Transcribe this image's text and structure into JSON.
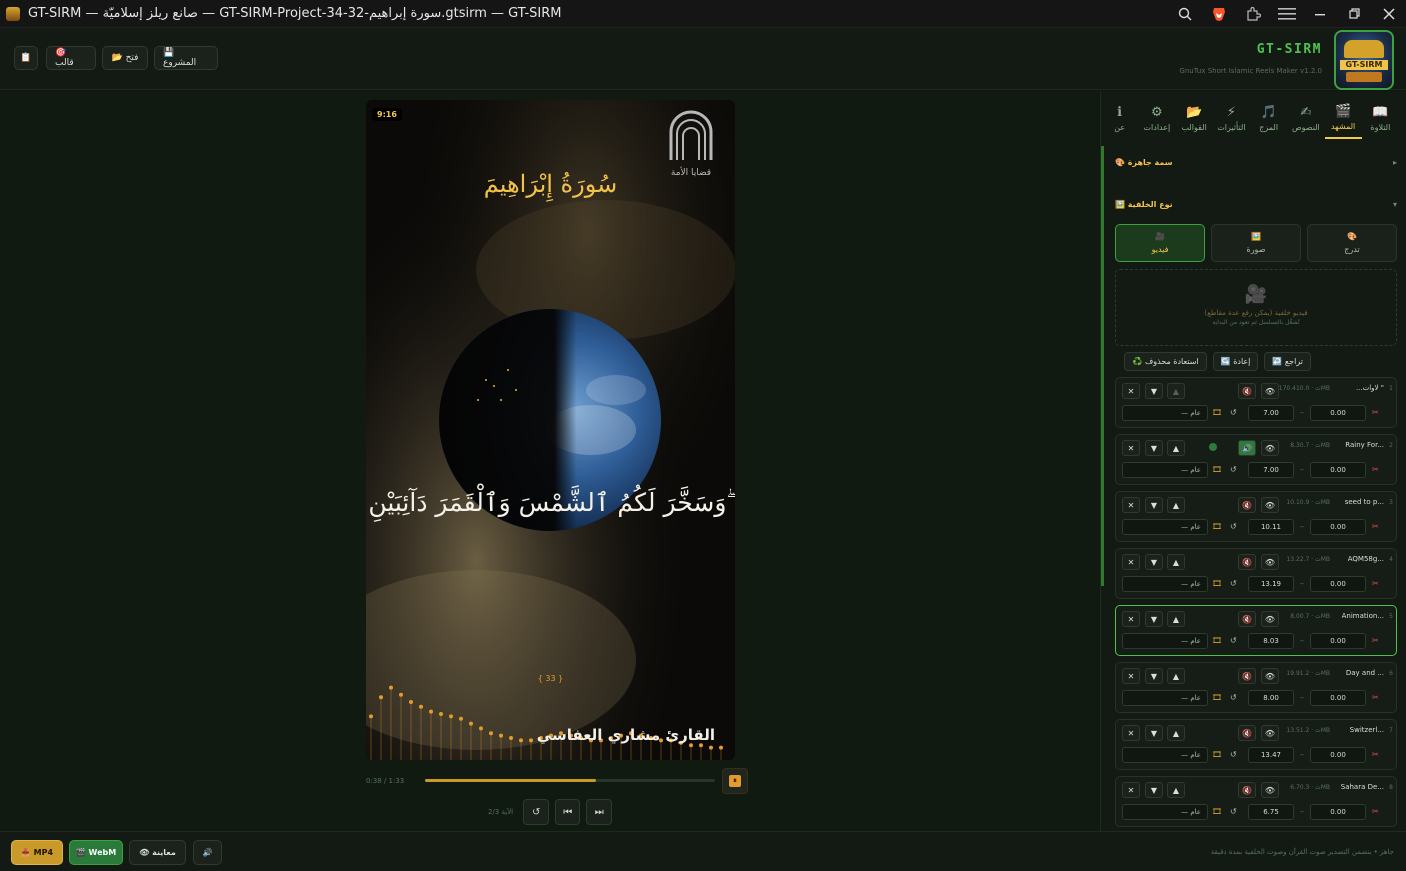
{
  "titlebar": {
    "title": "GT-SIRM — صانع ريلز إسلاميّة — GT-SIRM-Project-34-32-سورة إبراهيم.gtsirm — GT-SIRM",
    "icons": [
      "zoom-icon",
      "brave-lion-icon",
      "extensions-icon",
      "menu-icon",
      "minimize-icon",
      "restore-icon",
      "close-icon"
    ]
  },
  "header": {
    "project_label": "💾 المشروع",
    "open_label": "📂 فتح",
    "template_label": "🎯 قالب",
    "clipboard_label": "📋",
    "brand_name": "GT-SIRM",
    "brand_sub": "GnuTux Short Islamic Reels Maker v1.2.0",
    "logo_text": "GT-SIRM"
  },
  "preview": {
    "ratio_badge": "9:16",
    "surah_title": "سُورَةُ إِبْرَاهِيمَ",
    "ayah_text": "وَسَخَّرَ لَكُمُ ٱلشَّمْسَ وَٱلْقَمَرَ دَآئِبَيْنِ ۖ",
    "ayah_counter": "{ 33 }",
    "reciter": "القارئ مشاري العفاسي",
    "watermark_text": "قضايا الأمة",
    "time": "0:38 / 1:33",
    "progress": 0.59,
    "ayah_nav_label": "الآية 2/3",
    "pause_icon": "pause-icon"
  },
  "tabs": [
    {
      "icon": "📖",
      "label": "التلاوة"
    },
    {
      "icon": "🎬",
      "label": "المشهد",
      "active": true
    },
    {
      "icon": "✍",
      "label": "النصوص"
    },
    {
      "icon": "🎵",
      "label": "المزج"
    },
    {
      "icon": "⚡",
      "label": "التأثيرات"
    },
    {
      "icon": "📂",
      "label": "القوالب"
    },
    {
      "icon": "⚙",
      "label": "إعدادات"
    },
    {
      "icon": "ℹ",
      "label": "عن"
    }
  ],
  "sections": {
    "preset_title": "🎨 سمة جاهزة",
    "bg_type_title": "🖼️ نوع الخلفية",
    "collapsed_arrow": "▸",
    "expanded_arrow": "▾"
  },
  "bg_types": [
    {
      "icon": "🎨",
      "label": "تدرج"
    },
    {
      "icon": "🖼️",
      "label": "صورة"
    },
    {
      "icon": "🎥",
      "label": "فيديو",
      "active": true
    }
  ],
  "dropzone": {
    "icon": "🎥",
    "line1": "فيديو خلفية (يمكن رفع عدة مقاطع)",
    "line2": "تُشغَّل بالتسلسل ثم تعود من البداية"
  },
  "actions": {
    "undo": "↩️ تراجع",
    "redo": "↪️ إعادة",
    "restore": "♻️ استعادة محذوف"
  },
  "clips": [
    {
      "num": "1",
      "name": "...لاوات \"",
      "meta": "170.4ث · 10.0MB",
      "start": "0.00",
      "end": "7.00",
      "mode": "— عام"
    },
    {
      "num": "2",
      "name": "Rainy For...",
      "meta": "8.3ث · 0.7MB",
      "start": "0.00",
      "end": "7.00",
      "mode": "— عام"
    },
    {
      "num": "3",
      "name": "seed to p...",
      "meta": "10.1ث · 0.9MB",
      "start": "0.00",
      "end": "10.11",
      "mode": "— عام"
    },
    {
      "num": "4",
      "name": "AQM58g...",
      "meta": "13.2ث · 2.7MB",
      "start": "0.00",
      "end": "13.19",
      "mode": "— عام"
    },
    {
      "num": "5",
      "name": "Animation...",
      "meta": "8.0ث · 0.7MB",
      "start": "0.00",
      "end": "8.03",
      "mode": "— عام"
    },
    {
      "num": "6",
      "name": "Day and ...",
      "meta": "19.9ث · 1.2MB",
      "start": "0.00",
      "end": "8.00",
      "mode": "— عام"
    },
    {
      "num": "7",
      "name": "Switzerl...",
      "meta": "13.5ث · 1.2MB",
      "start": "0.00",
      "end": "13.47",
      "mode": "— عام"
    },
    {
      "num": "8",
      "name": "Sahara De...",
      "meta": "6.7ث · 0.3MB",
      "start": "0.00",
      "end": "6.75",
      "mode": "— عام"
    }
  ],
  "footer": {
    "mp4": "📥 MP4",
    "webm": "🎬 WebM",
    "preview": "👁 معاينة",
    "sound": "🔊",
    "status": "جاهز • يتضمن التصدير صوت القرآن وصوت الخلفية بمدة دقيقة"
  },
  "colors": {
    "accent": "#4ec24e",
    "gold": "#f2c24a",
    "orange": "#e59b2c"
  }
}
